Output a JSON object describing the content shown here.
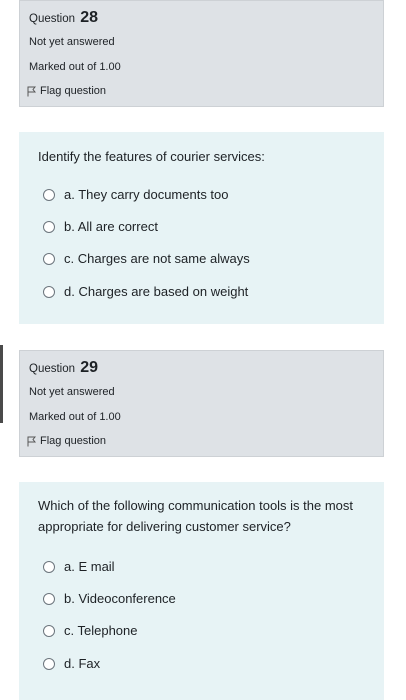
{
  "questions": [
    {
      "label": "Question",
      "number": "28",
      "status": "Not yet answered",
      "marked": "Marked out of 1.00",
      "flag": "Flag question",
      "text": "Identify the features of courier services:",
      "options": [
        "a. They carry documents too",
        "b. All are correct",
        "c. Charges are not same always",
        "d. Charges are based on weight"
      ]
    },
    {
      "label": "Question",
      "number": "29",
      "status": "Not yet answered",
      "marked": "Marked out of 1.00",
      "flag": "Flag question",
      "text": "Which of the following communication tools is the most appropriate for delivering customer service?",
      "options": [
        "a. E mail",
        "b. Videoconference",
        "c. Telephone",
        "d. Fax"
      ]
    }
  ],
  "colors": {
    "info_bg": "#dee2e6",
    "content_bg": "#e7f3f5",
    "text": "#1d2125"
  }
}
